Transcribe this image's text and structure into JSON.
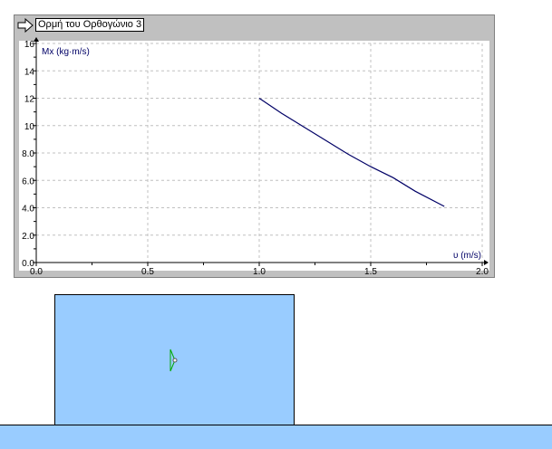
{
  "graph": {
    "title": "Ορμή του Ορθογώνιο 3",
    "arrow_icon": "right-arrow-icon"
  },
  "colors": {
    "window_bg": "#c0c0c0",
    "plot_bg": "#ffffff",
    "curve": "#000066",
    "grid": "#c0c0c0",
    "block": "#99ccff",
    "ground": "#99ccff",
    "marker": "#00aa00"
  },
  "chart_data": {
    "type": "line",
    "title": "",
    "xlabel": "υ (m/s)",
    "ylabel": "Mx (kg·m/s)",
    "xlim": [
      0.0,
      2.0
    ],
    "ylim": [
      0.0,
      16.0
    ],
    "x_ticks": [
      "0.0",
      "0.5",
      "1.0",
      "1.5",
      "2.0"
    ],
    "y_ticks": [
      "0.0",
      "2.0",
      "4.0",
      "6.0",
      "8.0",
      "10",
      "12",
      "14",
      "16"
    ],
    "grid": true,
    "series": [
      {
        "x": [
          1.0,
          1.1,
          1.2,
          1.3,
          1.4,
          1.5,
          1.6,
          1.7,
          1.83
        ],
        "y": [
          12.0,
          10.9,
          9.9,
          8.9,
          7.9,
          7.0,
          6.2,
          5.2,
          4.1
        ]
      }
    ]
  },
  "simulation": {
    "block_icon": "rectangle-body",
    "marker_icon": "center-of-mass-icon"
  }
}
